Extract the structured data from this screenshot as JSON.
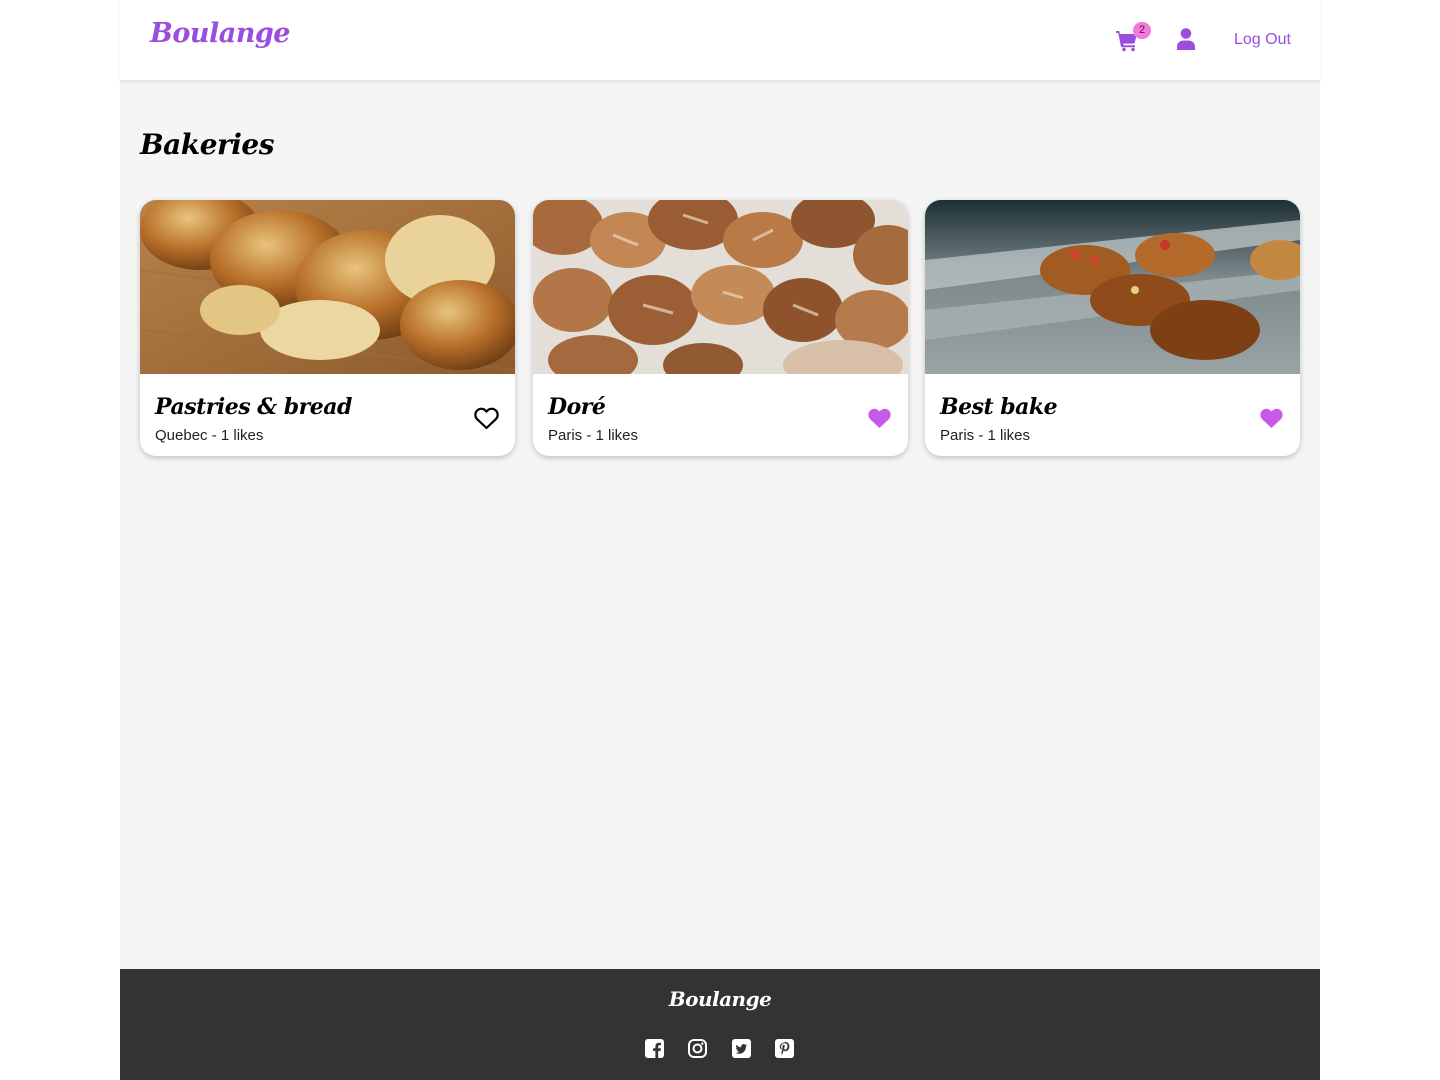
{
  "colors": {
    "brand": "#9b4de0",
    "badge": "#f27ad8",
    "liked": "#c75ae6",
    "footer": "#333333",
    "page_bg": "#f5f5f5"
  },
  "header": {
    "logo": "Boulange",
    "cart_icon": "shopping-cart-icon",
    "cart_count": "2",
    "user_icon": "user-icon",
    "logout_label": "Log Out"
  },
  "main": {
    "title": "Bakeries",
    "cards": [
      {
        "name": "Pastries & bread",
        "subtitle": "Quebec - 1 likes",
        "image": "braided-brioche-photo",
        "liked": false,
        "heart_icon": "heart-outline-icon"
      },
      {
        "name": "Doré",
        "subtitle": "Paris - 1 likes",
        "image": "bread-loaves-photo",
        "liked": true,
        "heart_icon": "heart-filled-icon"
      },
      {
        "name": "Best bake",
        "subtitle": "Paris - 1 likes",
        "image": "croissant-display-photo",
        "liked": true,
        "heart_icon": "heart-filled-icon"
      }
    ]
  },
  "footer": {
    "logo": "Boulange",
    "social_icons": [
      "facebook-icon",
      "instagram-icon",
      "twitter-icon",
      "pinterest-icon"
    ]
  }
}
